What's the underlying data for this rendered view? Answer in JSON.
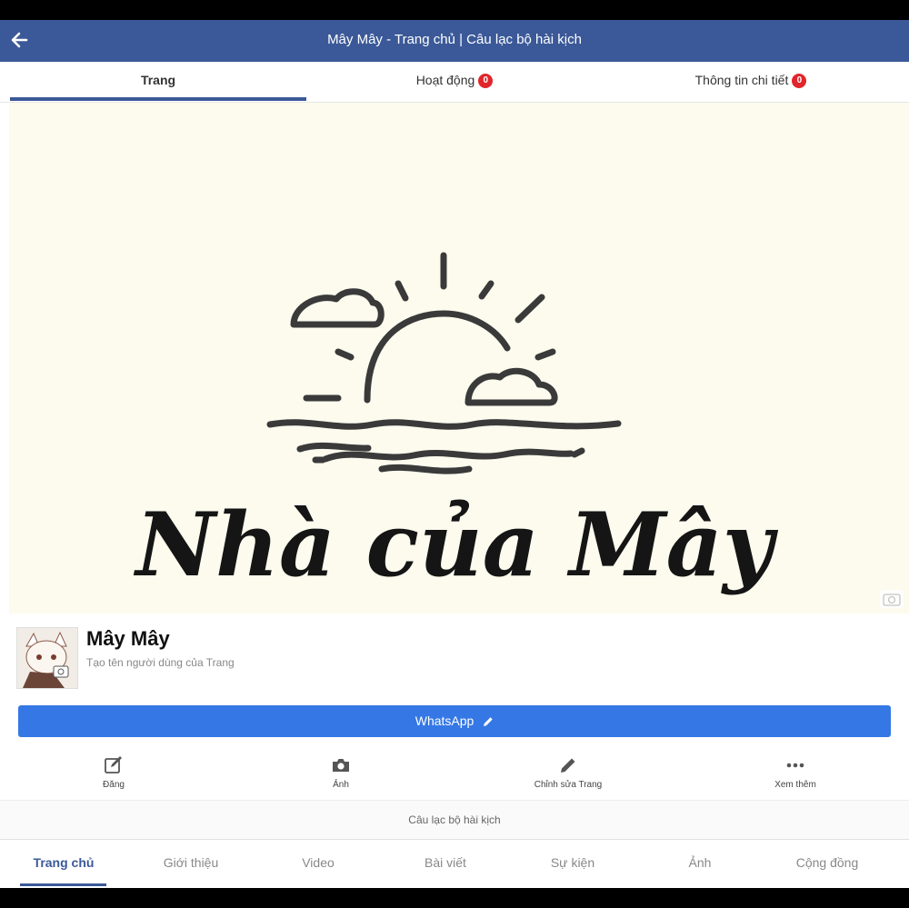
{
  "appbar": {
    "title": "Mây Mây - Trang chủ | Câu lạc bộ hài kịch",
    "back_icon": "arrow-left-icon"
  },
  "top_tabs": [
    {
      "label": "Trang",
      "badge": null,
      "active": true
    },
    {
      "label": "Hoạt động",
      "badge": "0",
      "active": false
    },
    {
      "label": "Thông tin chi tiết",
      "badge": "0",
      "active": false
    }
  ],
  "cover": {
    "logo_text": "Nhà của Mây",
    "background": "#fcfbee"
  },
  "profile": {
    "name": "Mây Mây",
    "username_prompt": "Tạo tên người dùng của Trang"
  },
  "whatsapp_button": {
    "label": "WhatsApp",
    "icon": "pencil-icon",
    "color": "#3578e5"
  },
  "actions": [
    {
      "label": "Đăng",
      "icon": "edit-square-icon"
    },
    {
      "label": "Ảnh",
      "icon": "camera-icon"
    },
    {
      "label": "Chỉnh sửa Trang",
      "icon": "pencil-icon"
    },
    {
      "label": "Xem thêm",
      "icon": "more-dots-icon"
    }
  ],
  "category": "Câu lạc bộ hài kịch",
  "bottom_nav": [
    {
      "label": "Trang chủ",
      "active": true
    },
    {
      "label": "Giới thiệu",
      "active": false
    },
    {
      "label": "Video",
      "active": false
    },
    {
      "label": "Bài viết",
      "active": false
    },
    {
      "label": "Sự kiện",
      "active": false
    },
    {
      "label": "Ảnh",
      "active": false
    },
    {
      "label": "Cộng đồng",
      "active": false
    }
  ],
  "colors": {
    "brand": "#3b5998",
    "badge": "#e0262b",
    "button": "#3578e5"
  }
}
